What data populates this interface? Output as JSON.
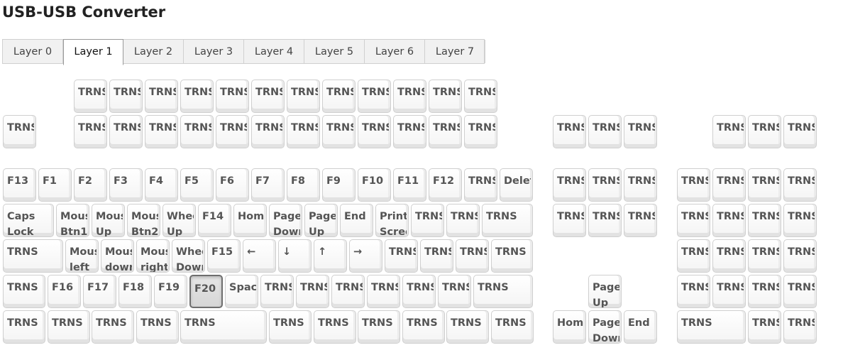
{
  "title": "USB-USB Converter",
  "tabs": [
    "Layer 0",
    "Layer 1",
    "Layer 2",
    "Layer 3",
    "Layer 4",
    "Layer 5",
    "Layer 6",
    "Layer 7"
  ],
  "active_tab_index": 1,
  "pressed_key": "F20",
  "rows": [
    {
      "labels": [
        "TRNS",
        "TRNS",
        "TRNS",
        "TRNS",
        "TRNS",
        "TRNS",
        "TRNS",
        "TRNS",
        "TRNS",
        "TRNS",
        "TRNS",
        "TRNS"
      ]
    },
    {
      "labels": [
        "TRNS",
        "TRNS",
        "TRNS",
        "TRNS",
        "TRNS",
        "TRNS",
        "TRNS",
        "TRNS",
        "TRNS",
        "TRNS",
        "TRNS",
        "TRNS",
        "TRNS",
        "TRNS",
        "TRNS",
        "TRNS",
        "TRNS",
        "TRNS",
        "TRNS"
      ]
    },
    {
      "labels": [
        "F13",
        "F1",
        "F2",
        "F3",
        "F4",
        "F5",
        "F6",
        "F7",
        "F8",
        "F9",
        "F10",
        "F11",
        "F12",
        "TRNS",
        "Delet",
        "TRNS",
        "TRNS",
        "TRNS",
        "TRNS",
        "TRNS",
        "TRNS",
        "TRNS"
      ]
    },
    {
      "labels": [
        "Caps\nLock",
        "Mous\nBtn1",
        "Mous\nUp",
        "Mous\nBtn2",
        "Whee\nUp",
        "F14",
        "Hom",
        "Page\nDowr",
        "Page\nUp",
        "End",
        "Print\nScree",
        "TRNS",
        "TRNS",
        "TRNS",
        "TRNS",
        "TRNS",
        "TRNS",
        "TRNS",
        "TRNS",
        "TRNS",
        "TRNS"
      ]
    },
    {
      "labels": [
        "TRNS",
        "Mous\nleft",
        "Mous\ndowr",
        "Mous\nright",
        "Whee\nDowr",
        "F15",
        "←",
        "↓",
        "↑",
        "→",
        "TRNS",
        "TRNS",
        "TRNS",
        "TRNS",
        "TRNS",
        "TRNS",
        "TRNS",
        "TRNS"
      ]
    },
    {
      "labels": [
        "TRNS",
        "F16",
        "F17",
        "F18",
        "F19",
        "F20",
        "Spac",
        "TRNS",
        "TRNS",
        "TRNS",
        "TRNS",
        "TRNS",
        "TRNS",
        "TRNS",
        "Page\nUp",
        "TRNS",
        "TRNS",
        "TRNS",
        "TRNS"
      ]
    },
    {
      "labels": [
        "TRNS",
        "TRNS",
        "TRNS",
        "TRNS",
        "TRNS",
        "TRNS",
        "TRNS",
        "TRNS",
        "TRNS",
        "TRNS",
        "TRNS",
        "Hom",
        "Page\nDowr",
        "End",
        "TRNS",
        "TRNS",
        "TRNS"
      ]
    }
  ]
}
